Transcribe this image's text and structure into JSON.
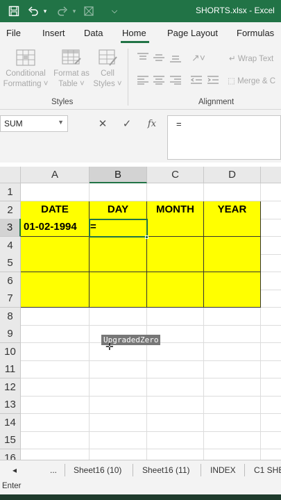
{
  "app": {
    "file_title": "SHORTS.xlsx  -  Excel",
    "colors": {
      "accent": "#217346",
      "yellow_fill": "#ffff00"
    }
  },
  "quick_access": {
    "icons": [
      "save-icon",
      "undo-icon",
      "undo-dropdown-icon",
      "redo-icon",
      "redo-dropdown-icon",
      "format-painter-icon",
      "customize-dropdown-icon"
    ]
  },
  "ribbon_tabs": [
    "File",
    "Insert",
    "Data",
    "Home",
    "Page Layout",
    "Formulas"
  ],
  "active_tab": "Home",
  "ribbon": {
    "styles": {
      "conditional_line1": "Conditional",
      "conditional_line2": "Formatting ˅",
      "format_table_line1": "Format as",
      "format_table_line2": "Table ˅",
      "cell_styles_line1": "Cell",
      "cell_styles_line2": "Styles ˅",
      "group_label": "Styles"
    },
    "alignment": {
      "wrap_text": "Wrap Text",
      "merge_center": "Merge & C",
      "group_label": "Alignment"
    }
  },
  "formula_bar": {
    "name_box": "SUM",
    "cancel": "✕",
    "enter": "✓",
    "fx": "fx",
    "content": "="
  },
  "sheet": {
    "columns": [
      "A",
      "B",
      "C",
      "D"
    ],
    "selected_column": "B",
    "rows": [
      "1",
      "2",
      "3",
      "4",
      "5",
      "6",
      "7",
      "8",
      "9",
      "10",
      "11",
      "12",
      "13",
      "14",
      "15",
      "16"
    ],
    "selected_row": "3",
    "headers": {
      "a": "DATE",
      "b": "DAY",
      "c": "MONTH",
      "d": "YEAR"
    },
    "a3": "01-02-1994",
    "b3": "="
  },
  "watermark": "UpgradedZero",
  "sheet_tabs": {
    "nav_prev": "◂",
    "more": "...",
    "tabs": [
      "Sheet16 (10)",
      "Sheet16 (11)",
      "INDEX",
      "C1 SHE"
    ]
  },
  "status": {
    "mode": "Enter"
  }
}
